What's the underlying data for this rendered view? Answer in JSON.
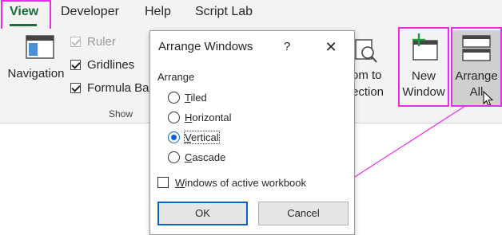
{
  "tabs": [
    {
      "label": "View",
      "active": true
    },
    {
      "label": "Developer",
      "active": false
    },
    {
      "label": "Help",
      "active": false
    },
    {
      "label": "Script Lab",
      "active": false
    }
  ],
  "ribbon": {
    "navigation_label": "Navigation",
    "show_group": {
      "label": "Show",
      "ruler": {
        "label": "Ruler",
        "checked": true,
        "disabled": true
      },
      "gridlines": {
        "label": "Gridlines",
        "checked": true
      },
      "formula_bar": {
        "label": "Formula Ba"
      }
    },
    "zoom_to_selection": {
      "line1": "om to",
      "line2": "ection"
    },
    "new_window": {
      "line1": "New",
      "line2": "Window"
    },
    "arrange_all": {
      "line1": "Arrange",
      "line2": "All"
    }
  },
  "dialog": {
    "title": "Arrange Windows",
    "help": "?",
    "close": "✕",
    "group_label": "Arrange",
    "options": [
      {
        "label": "Tiled",
        "mnemonic_index": 0,
        "checked": false
      },
      {
        "label": "Horizontal",
        "mnemonic_index": 0,
        "checked": false
      },
      {
        "label": "Vertical",
        "mnemonic_index": 0,
        "checked": true
      },
      {
        "label": "Cascade",
        "mnemonic_index": 0,
        "checked": false
      }
    ],
    "active_workbook": {
      "label": "Windows of active workbook",
      "checked": false
    },
    "ok_label": "OK",
    "cancel_label": "Cancel"
  },
  "colors": {
    "highlight": "#e62ee6",
    "accent_green": "#1e6b3b",
    "radio_blue": "#0a64c8"
  }
}
